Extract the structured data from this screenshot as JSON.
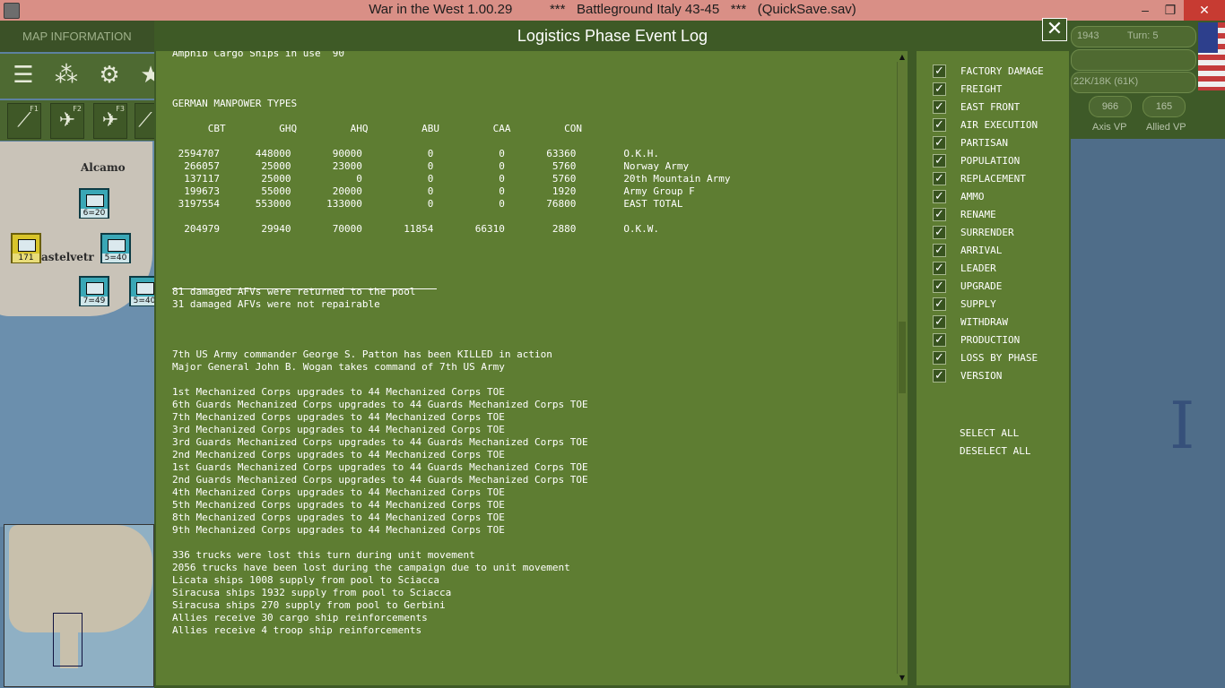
{
  "window": {
    "title": "War in the West 1.00.29          ***   Battleground Italy 43-45   ***   (QuickSave.sav)",
    "minimize": "–",
    "maximize": "❐",
    "close": "✕"
  },
  "left_panel": {
    "tab_label": "MAP INFORMATION",
    "toolbar_f_keys": [
      "F1",
      "F2",
      "F3"
    ],
    "cities": [
      "Alcamo",
      "astelvetr"
    ],
    "units": [
      "6=20",
      "5=40",
      "7=49",
      "5=40",
      "171"
    ]
  },
  "right_panel": {
    "date_fragment": "1943",
    "turn": "Turn: 5",
    "strength": "22K/18K (61K)",
    "axis_vp_value": "966",
    "axis_vp_label": "Axis VP",
    "allied_vp_value": "165",
    "allied_vp_label": "Allied VP",
    "map_letter": "I"
  },
  "dialog": {
    "title": "Logistics Phase Event Log",
    "close_label": "✕",
    "log_lines": [
      "Amphib Cargo Ships in use  90",
      "",
      "",
      "",
      "GERMAN MANPOWER TYPES",
      "",
      "      CBT         GHQ         AHQ         ABU         CAA         CON",
      "",
      " 2594707      448000       90000           0           0       63360        O.K.H.",
      "  266057       25000       23000           0           0        5760        Norway Army",
      "  137117       25000           0           0           0        5760        20th Mountain Army",
      "  199673       55000       20000           0           0        1920        Army Group F",
      " 3197554      553000      133000           0           0       76800        EAST TOTAL",
      "",
      "  204979       29940       70000       11854       66310        2880        O.K.W.",
      "",
      "",
      "",
      "",
      "81 damaged AFVs were returned to the pool",
      "31 damaged AFVs were not repairable",
      "",
      "",
      "",
      "7th US Army commander George S. Patton has been KILLED in action",
      "Major General John B. Wogan takes command of 7th US Army",
      "",
      "1st Mechanized Corps upgrades to 44 Mechanized Corps TOE",
      "6th Guards Mechanized Corps upgrades to 44 Guards Mechanized Corps TOE",
      "7th Mechanized Corps upgrades to 44 Mechanized Corps TOE",
      "3rd Mechanized Corps upgrades to 44 Mechanized Corps TOE",
      "3rd Guards Mechanized Corps upgrades to 44 Guards Mechanized Corps TOE",
      "2nd Mechanized Corps upgrades to 44 Mechanized Corps TOE",
      "1st Guards Mechanized Corps upgrades to 44 Guards Mechanized Corps TOE",
      "2nd Guards Mechanized Corps upgrades to 44 Guards Mechanized Corps TOE",
      "4th Mechanized Corps upgrades to 44 Mechanized Corps TOE",
      "5th Mechanized Corps upgrades to 44 Mechanized Corps TOE",
      "8th Mechanized Corps upgrades to 44 Mechanized Corps TOE",
      "9th Mechanized Corps upgrades to 44 Mechanized Corps TOE",
      "",
      "336 trucks were lost this turn during unit movement",
      "2056 trucks have been lost during the campaign due to unit movement",
      "Licata ships 1008 supply from pool to Sciacca",
      "Siracusa ships 1932 supply from pool to Sciacca",
      "Siracusa ships 270 supply from pool to Gerbini",
      "Allies receive 30 cargo ship reinforcements",
      "Allies receive 4 troop ship reinforcements"
    ],
    "filters": [
      {
        "label": "FACTORY DAMAGE",
        "checked": true
      },
      {
        "label": "FREIGHT",
        "checked": true
      },
      {
        "label": "EAST FRONT",
        "checked": true
      },
      {
        "label": "AIR EXECUTION",
        "checked": true
      },
      {
        "label": "PARTISAN",
        "checked": true
      },
      {
        "label": "POPULATION",
        "checked": true
      },
      {
        "label": "REPLACEMENT",
        "checked": true
      },
      {
        "label": "AMMO",
        "checked": true
      },
      {
        "label": "RENAME",
        "checked": true
      },
      {
        "label": "SURRENDER",
        "checked": true
      },
      {
        "label": "ARRIVAL",
        "checked": true
      },
      {
        "label": "LEADER",
        "checked": true
      },
      {
        "label": "UPGRADE",
        "checked": true
      },
      {
        "label": "SUPPLY",
        "checked": true
      },
      {
        "label": "WITHDRAW",
        "checked": true
      },
      {
        "label": "PRODUCTION",
        "checked": true
      },
      {
        "label": "LOSS BY PHASE",
        "checked": true
      },
      {
        "label": "VERSION",
        "checked": true
      }
    ],
    "select_all": "SELECT ALL",
    "deselect_all": "DESELECT ALL",
    "check_glyph": "✓"
  }
}
